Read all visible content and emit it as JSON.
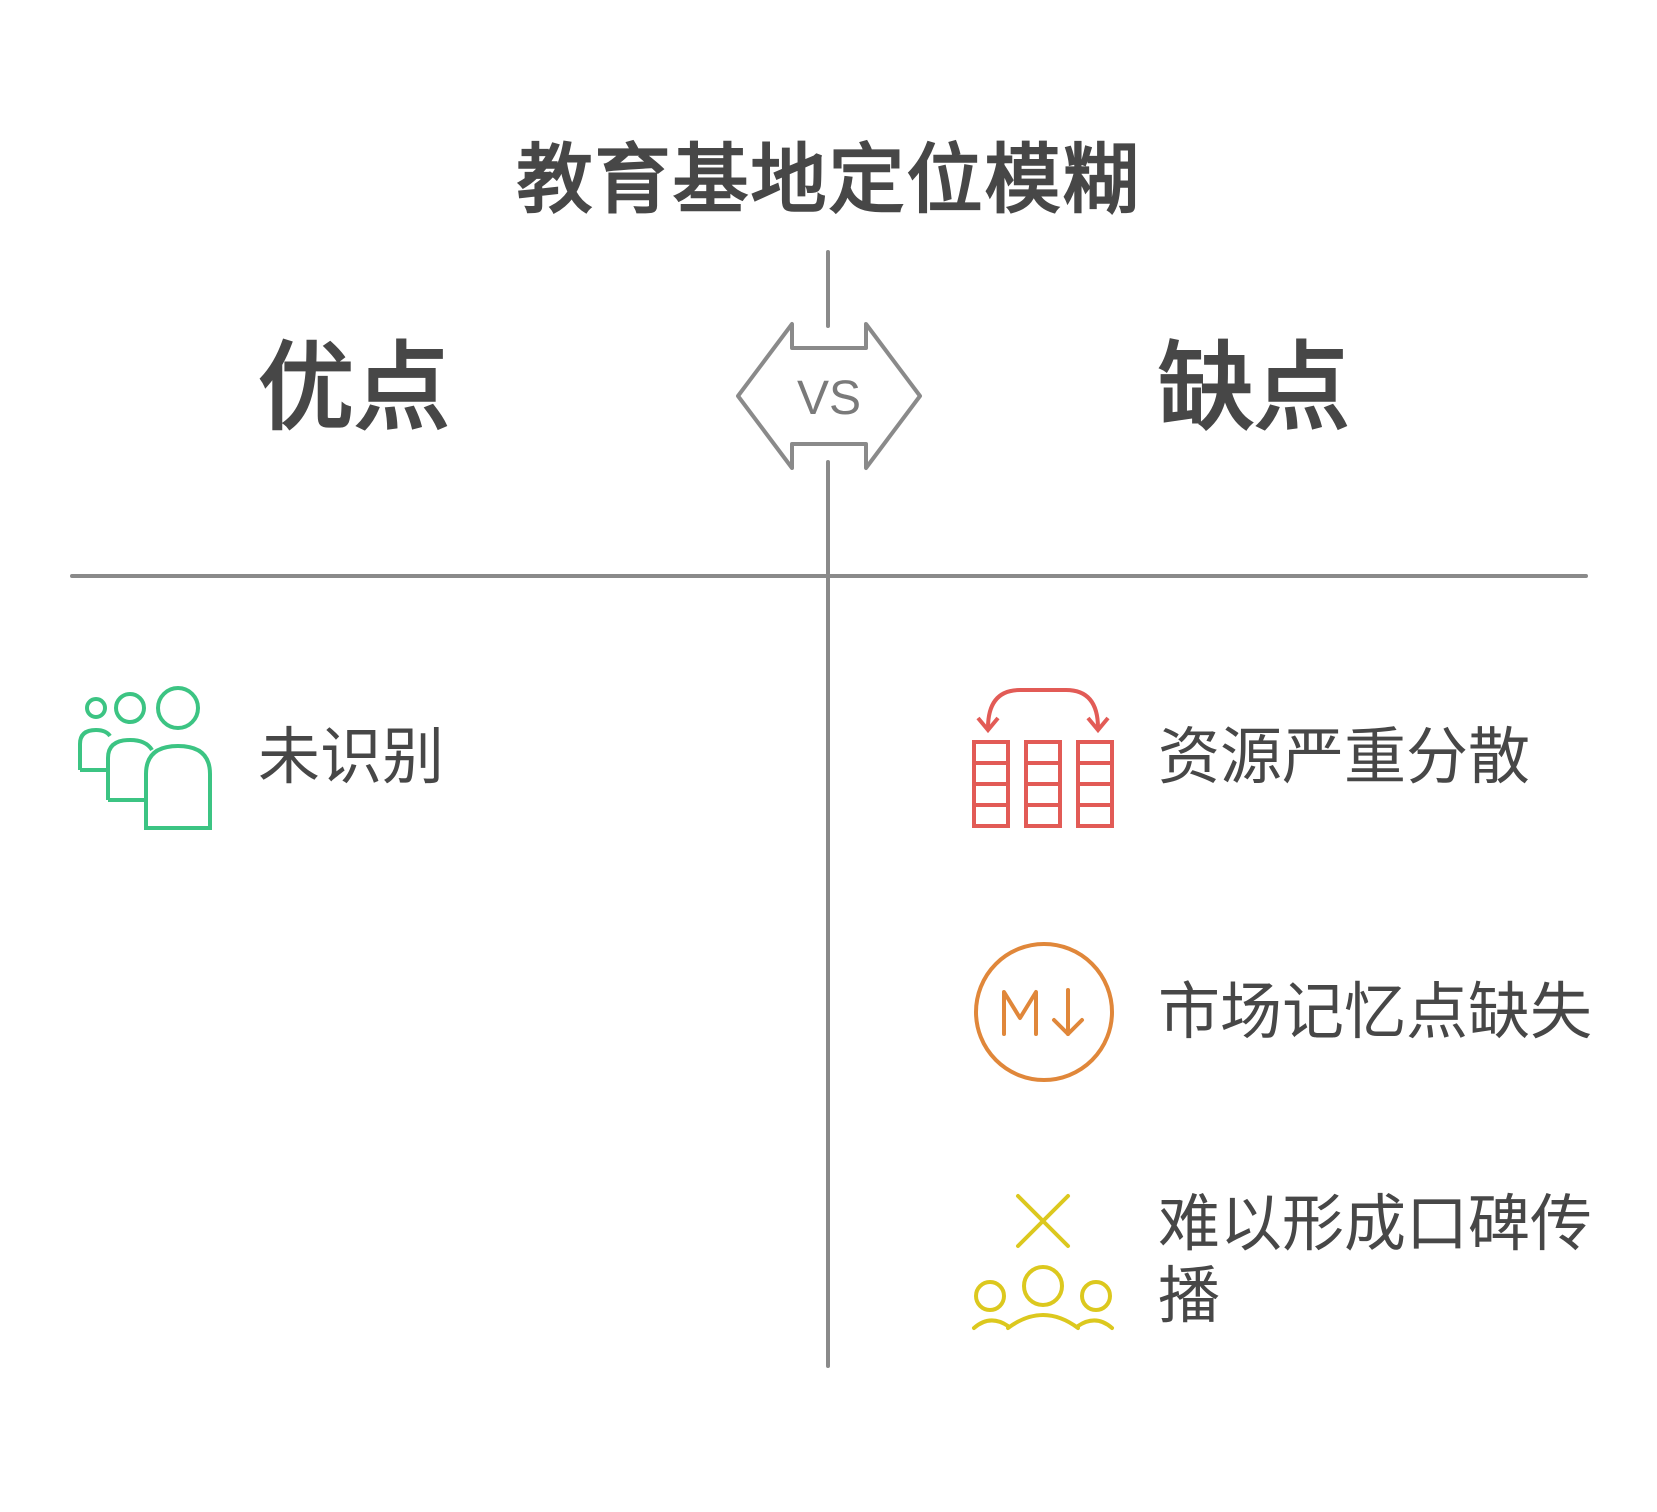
{
  "title": "教育基地定位模糊",
  "vs_label": "VS",
  "columns": {
    "pros": {
      "heading": "优点",
      "items": [
        {
          "label": "未识别",
          "icon": "people-group-icon",
          "color": "#3cc483"
        }
      ]
    },
    "cons": {
      "heading": "缺点",
      "items": [
        {
          "label": "资源严重分散",
          "icon": "scattered-grid-arrows-icon",
          "color": "#e25b56"
        },
        {
          "label": "市场记忆点缺失",
          "icon": "memory-down-circle-icon",
          "color": "#e0873a"
        },
        {
          "label": "难以形成口碑传播",
          "icon": "no-word-of-mouth-icon",
          "color": "#dcc81e"
        }
      ]
    }
  },
  "colors": {
    "text": "#474747",
    "divider": "#8a8a8a"
  }
}
